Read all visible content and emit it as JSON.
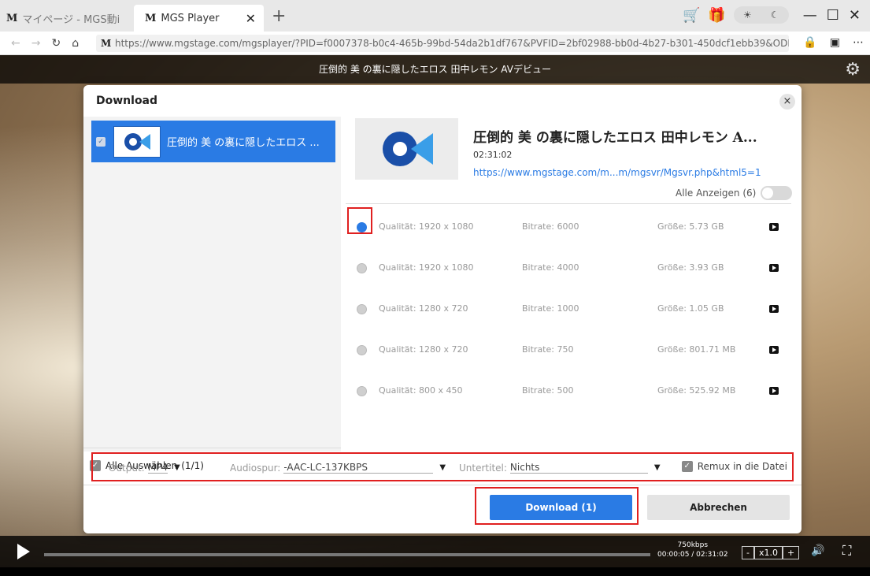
{
  "browser": {
    "tabs": [
      {
        "label": "マイページ - MGS動i",
        "logo": "M"
      },
      {
        "label": "MGS Player",
        "logo": "M"
      }
    ],
    "url": "https://www.mgstage.com/mgsplayer/?PID=f0007378-b0c4-465b-99bd-54da2b1df767&PVFID=2bf02988-bb0d-4b27-b301-450dcf1ebb39&ODID=23d6e850-5",
    "url_logo": "M"
  },
  "player": {
    "title": "圧倒的 美 の裏に隠したエロス 田中レモン AVデビュー",
    "bitrate": "750kbps",
    "time": "00:00:05 / 02:31:02",
    "speed_minus": "-",
    "speed": "x1.0",
    "speed_plus": "+"
  },
  "dialog": {
    "title": "Download",
    "close": "×",
    "list_item": "圧倒的 美 の裏に隠したエロス ...",
    "select_all": "Alle Auswählen",
    "select_count": "(1/1)",
    "detail": {
      "title": "圧倒的 美 の裏に隠したエロス 田中レモン A...",
      "duration": "02:31:02",
      "url": "https://www.mgstage.com/m...m/mgsvr/Mgsvr.php&html5=1",
      "show_all": "Alle Anzeigen (6)"
    },
    "qualities": [
      {
        "quality": "Qualität: 1920 x 1080",
        "bitrate": "Bitrate: 6000",
        "size": "Größe: 5.73 GB",
        "selected": true
      },
      {
        "quality": "Qualität: 1920 x 1080",
        "bitrate": "Bitrate: 4000",
        "size": "Größe: 3.93 GB",
        "selected": false
      },
      {
        "quality": "Qualität: 1280 x 720",
        "bitrate": "Bitrate: 1000",
        "size": "Größe: 1.05 GB",
        "selected": false
      },
      {
        "quality": "Qualität: 1280 x 720",
        "bitrate": "Bitrate: 750",
        "size": "Größe: 801.71 MB",
        "selected": false
      },
      {
        "quality": "Qualität: 800 x 450",
        "bitrate": "Bitrate: 500",
        "size": "Größe: 525.92 MB",
        "selected": false
      }
    ],
    "options": {
      "output_label": "Output:",
      "output_value": "MP4",
      "audio_label": "Audiospur:",
      "audio_value": "-AAC-LC-137KBPS",
      "subtitle_label": "Untertitel:",
      "subtitle_value": "Nichts",
      "remux_label": "Remux in die Datei"
    },
    "download_button": "Download (1)",
    "cancel_button": "Abbrechen"
  },
  "colors": {
    "accent": "#2a7be4",
    "highlight": "#e02020"
  }
}
